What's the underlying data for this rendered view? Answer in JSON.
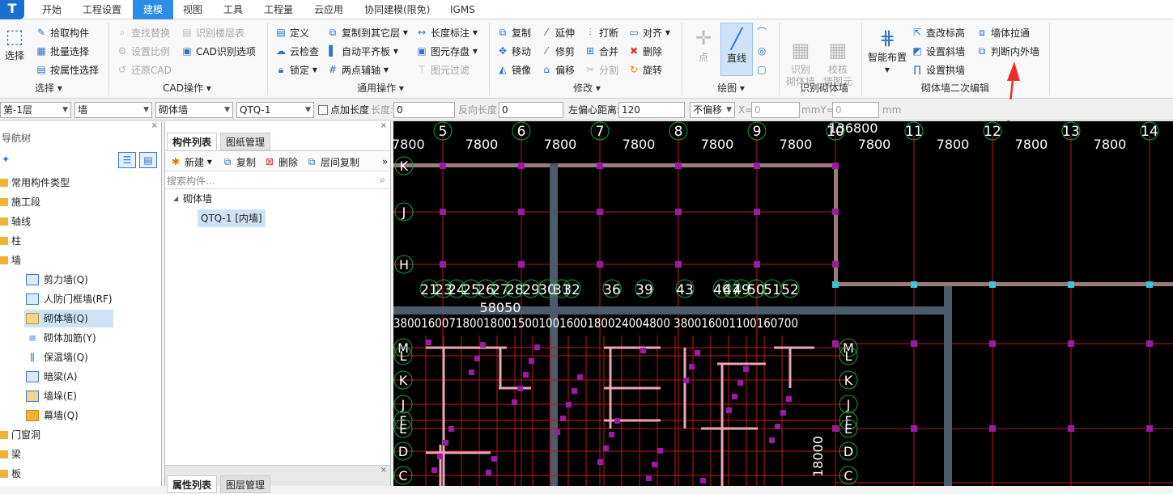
{
  "app": {
    "logo": "T"
  },
  "menu": {
    "tabs": [
      "开始",
      "工程设置",
      "建模",
      "视图",
      "工具",
      "工程量",
      "云应用",
      "协同建模(限免)",
      "IGMS"
    ],
    "active": "建模"
  },
  "ribbon": {
    "select": {
      "big": "选择",
      "items": [
        "拾取构件",
        "批量选择",
        "按属性选择"
      ],
      "label": "选择"
    },
    "cad": {
      "items": [
        "查找替换",
        "识别楼层表",
        "设置比例",
        "CAD识别选项",
        "还原CAD"
      ],
      "label": "CAD操作"
    },
    "general": {
      "items": [
        "定义",
        "复制到其它层",
        "长度标注",
        "云检查",
        "自动平齐板",
        "图元存盘",
        "锁定",
        "两点辅轴",
        "图元过滤"
      ],
      "label": "通用操作"
    },
    "modify": {
      "items": [
        "复制",
        "延伸",
        "打断",
        "对齐",
        "移动",
        "修剪",
        "合并",
        "删除",
        "镜像",
        "偏移",
        "分割",
        "旋转"
      ],
      "label": "修改"
    },
    "draw": {
      "point": "点",
      "line": "直线",
      "label": "绘图"
    },
    "recognize": {
      "b1": "识别\n砌体墙",
      "b2": "校核\n墙图元",
      "label": "识别砌体墙"
    },
    "edit2": {
      "big": "智能布置",
      "items": [
        "查改标高",
        "墙体拉通",
        "设置斜墙",
        "判断内外墙",
        "设置拱墙"
      ],
      "label": "砌体墙二次编辑"
    }
  },
  "props": {
    "floor": "第-1层",
    "type": "墙",
    "subtype": "砌体墙",
    "comp": "QTQ-1",
    "cb_label": "点加长度",
    "len": "长度:",
    "len_val": "0",
    "rev": "反向长度:",
    "rev_val": "0",
    "off_label": "左偏心距离:",
    "off_val": "120",
    "mode": "不偏移",
    "x_label": "X=",
    "x_val": "0",
    "y_label": "mmY=",
    "y_val": "0",
    "unit": "mm"
  },
  "nav": {
    "title": "导航树",
    "items": [
      "常用构件类型",
      "施工段",
      "轴线",
      "柱",
      "墙"
    ],
    "wall_items": [
      "剪力墙(Q)",
      "人防门框墙(RF)",
      "砌体墙(Q)",
      "砌体加筋(Y)",
      "保温墙(Q)",
      "暗梁(A)",
      "墙垛(E)",
      "幕墙(Q)"
    ],
    "after": [
      "门窗洞",
      "梁",
      "板"
    ]
  },
  "list": {
    "tabs": [
      "构件列表",
      "图纸管理"
    ],
    "actions": [
      "新建",
      "复制",
      "删除",
      "层间复制"
    ],
    "search_placeholder": "搜索构件...",
    "group": "砌体墙",
    "item": "QTQ-1 [内墙]",
    "tabs2": [
      "属性列表",
      "图层管理"
    ]
  },
  "cad": {
    "top_axes": [
      "5",
      "6",
      "7",
      "8",
      "9",
      "10",
      "11",
      "12",
      "13",
      "14"
    ],
    "top_dims": [
      "7800",
      "7800",
      "7800",
      "7800",
      "7800",
      "7800",
      "7800",
      "7800",
      "7800",
      "7800"
    ],
    "total": "136800",
    "rows_top": [
      "K",
      "J",
      "H"
    ],
    "mid_axes": [
      "21",
      "23",
      "24",
      "25",
      "26",
      "27",
      "28",
      "29",
      "30",
      "31",
      "32",
      "36",
      "39",
      "43",
      "46",
      "47",
      "49",
      "50",
      "51",
      "52"
    ],
    "mid_total": "58050",
    "mid_dims": "3800160071800180015001001600180024004800 380016001100160700",
    "rows_bottom": [
      "M",
      "L",
      "K",
      "J",
      "F",
      "E",
      "D",
      "C"
    ],
    "side_dim": "18000",
    "left_cut": "7800"
  }
}
